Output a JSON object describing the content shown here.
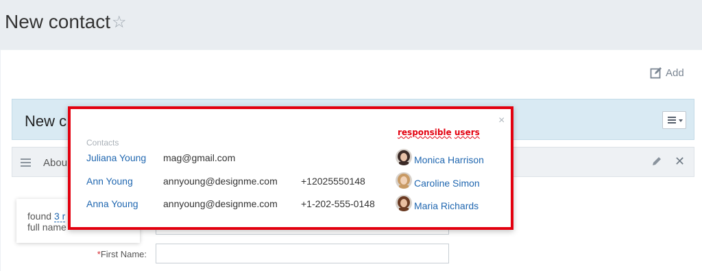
{
  "header": {
    "title": "New contact",
    "star_glyph": "☆"
  },
  "toolbar": {
    "add_label": "Add"
  },
  "form": {
    "title_visible": "New c",
    "section_title_visible": "Abou"
  },
  "duplicates_hint": {
    "prefix": "found ",
    "count_visible": "3 r",
    "second_line_visible": "full name"
  },
  "first_name_field": {
    "label": "First Name:",
    "required_mark": "*",
    "value": ""
  },
  "contacts_popup": {
    "contacts_heading": "Contacts",
    "responsible_heading_word1": "responsible",
    "responsible_heading_word2": "users",
    "close_glyph": "×",
    "rows": [
      {
        "name": "Juliana Young",
        "email": "mag@gmail.com",
        "phone": "",
        "user": "Monica Harrison",
        "avatar_colors": [
          "#3b2a26",
          "#e7c1a8"
        ]
      },
      {
        "name": "Ann Young",
        "email": "annyoung@designme.com",
        "phone": "+12025550148",
        "user": "Caroline Simon",
        "avatar_colors": [
          "#c89a64",
          "#f1d2b8"
        ]
      },
      {
        "name": "Anna Young",
        "email": "annyoung@designme.com",
        "phone": "+1-202-555-0148",
        "user": "Maria Richards",
        "avatar_colors": [
          "#6a3a22",
          "#e9bfa1"
        ]
      }
    ]
  },
  "colors": {
    "link": "#2067b0",
    "highlight_border": "#e3000f",
    "form_header_bg": "#d9eaf3"
  }
}
